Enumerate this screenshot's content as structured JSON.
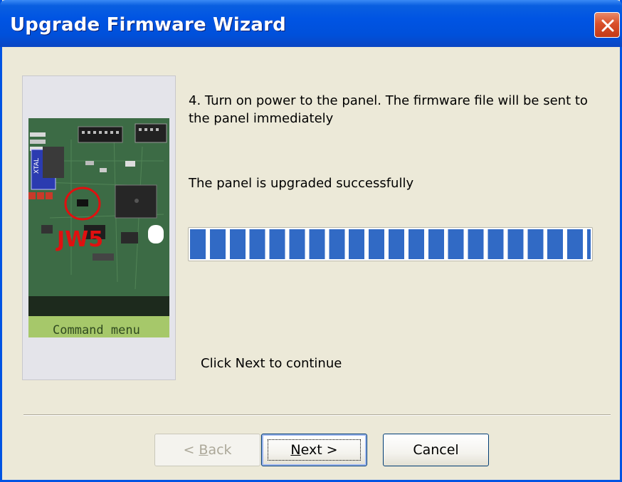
{
  "window": {
    "title": "Upgrade Firmware Wizard",
    "close_icon": "close-icon"
  },
  "image": {
    "description_icon": "circuit-board-photo",
    "jumper_label": "JW5",
    "lcd_text": "Command menu",
    "chip_text": "XTAL"
  },
  "content": {
    "step_text": "4. Turn on power to the panel. The firmware file will be sent to the panel immediately",
    "status_text": "The panel is upgraded successfully",
    "progress_percent": 100,
    "progress_segments": 20,
    "continue_text": "Click  Next  to continue"
  },
  "buttons": {
    "back": {
      "prefix": "< ",
      "mnemonic": "B",
      "suffix": "ack",
      "enabled": false
    },
    "next": {
      "prefix": "",
      "mnemonic": "N",
      "suffix": "ext >",
      "enabled": true,
      "default": true
    },
    "cancel": {
      "label": "Cancel",
      "enabled": true
    }
  },
  "colors": {
    "title_bar": "#0054e3",
    "progress": "#316ac5",
    "close_button": "#d9502a",
    "jumper_highlight": "#e01010",
    "lcd_background": "#a6c86a"
  }
}
